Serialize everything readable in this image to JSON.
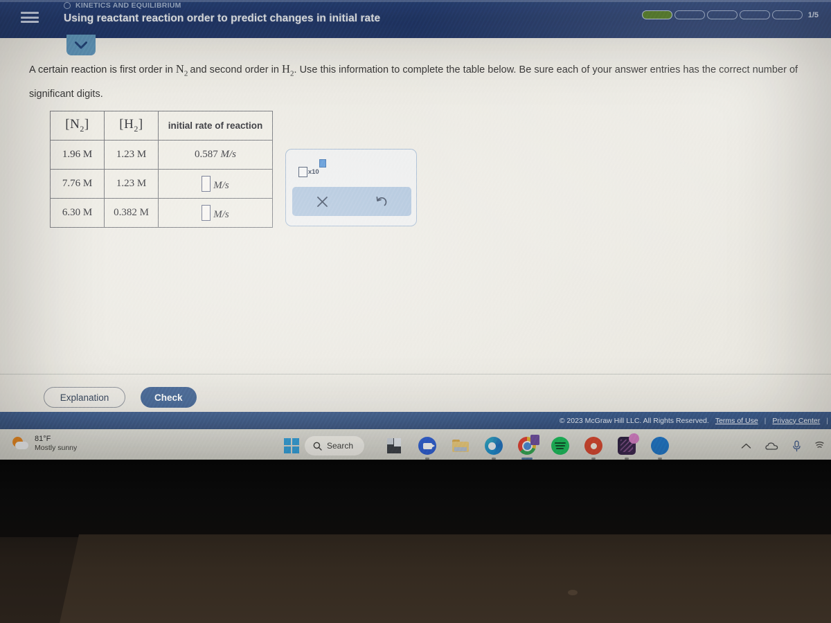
{
  "app": {
    "menu_icon": "hamburger-menu-icon",
    "eyebrow": "KINETICS AND EQUILIBRIUM",
    "title": "Using reactant reaction order to predict changes in initial rate",
    "progress": {
      "label": "1/5",
      "total_segments": 5,
      "filled_segments": 1,
      "filled_color": "#4c7a1c"
    },
    "tab_chevron_icon": "chevron-down-icon"
  },
  "question": {
    "text_part1": "A certain reaction is first order in",
    "species1": "N",
    "species1_sub": "2",
    "text_part2": "and second order in",
    "species2": "H",
    "species2_sub": "2",
    "text_part3": ". Use this information to complete the table below. Be sure each of your answer entries has the correct number of significant digits."
  },
  "table": {
    "headers": {
      "col1_species": "N",
      "col1_sub": "2",
      "col2_species": "H",
      "col2_sub": "2",
      "col3": "initial rate of reaction"
    },
    "rows": [
      {
        "n2": "1.96 M",
        "h2": "1.23 M",
        "rate_value": "0.587",
        "rate_unit": "M/s",
        "has_input": false
      },
      {
        "n2": "7.76 M",
        "h2": "1.23 M",
        "rate_value": "",
        "rate_unit": "M/s",
        "has_input": true
      },
      {
        "n2": "6.30 M",
        "h2": "0.382 M",
        "rate_value": "",
        "rate_unit": "M/s",
        "has_input": true
      }
    ]
  },
  "palette": {
    "sci_notation_label": "x10",
    "sci_notation_icon": "scientific-notation-icon",
    "clear_icon": "close-x-icon",
    "undo_icon": "undo-arrow-icon"
  },
  "actions": {
    "explanation_label": "Explanation",
    "check_label": "Check",
    "check_color": "#3f6293"
  },
  "footer": {
    "copyright": "© 2023 McGraw Hill LLC. All Rights Reserved.",
    "terms_label": "Terms of Use",
    "separator1": "|",
    "privacy_label": "Privacy Center",
    "separator2": "|"
  },
  "taskbar": {
    "weather": {
      "temperature": "81°F",
      "condition": "Mostly sunny",
      "icon": "sun-cloud-icon"
    },
    "start_icon": "windows-start-icon",
    "search": {
      "label": "Search",
      "icon": "search-icon"
    },
    "apps": [
      {
        "name": "file-explorer",
        "icon": "file-explorer-icon"
      },
      {
        "name": "zoom",
        "icon": "video-camera-icon"
      },
      {
        "name": "folder",
        "icon": "folder-icon"
      },
      {
        "name": "microsoft-edge",
        "icon": "edge-icon"
      },
      {
        "name": "google-chrome",
        "icon": "chrome-icon"
      },
      {
        "name": "spotify",
        "icon": "spotify-icon"
      },
      {
        "name": "red-app",
        "icon": "red-circle-icon"
      },
      {
        "name": "dark-app",
        "icon": "dark-tile-icon"
      },
      {
        "name": "blue-app",
        "icon": "blue-circle-icon"
      }
    ],
    "tray": [
      {
        "name": "show-hidden-icons",
        "icon": "chevron-up-icon"
      },
      {
        "name": "onedrive",
        "icon": "cloud-icon"
      },
      {
        "name": "microphone",
        "icon": "microphone-icon"
      },
      {
        "name": "network",
        "icon": "wifi-icon"
      }
    ]
  }
}
